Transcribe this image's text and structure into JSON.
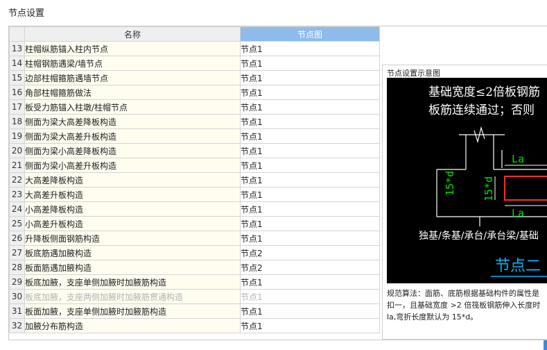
{
  "dialog": {
    "title": "节点设置"
  },
  "table": {
    "headers": {
      "name": "名称",
      "node": "节点图"
    },
    "rows": [
      {
        "num": "13",
        "name": "柱帽纵筋锚入柱内节点",
        "node": "节点1"
      },
      {
        "num": "14",
        "name": "柱帽钢筋遇梁/墙节点",
        "node": "节点1"
      },
      {
        "num": "15",
        "name": "边部柱帽箍筋遇墙节点",
        "node": "节点1"
      },
      {
        "num": "16",
        "name": "角部柱帽箍筋做法",
        "node": "节点1"
      },
      {
        "num": "17",
        "name": "板受力筋锚入柱墩/柱帽节点",
        "node": "节点1"
      },
      {
        "num": "18",
        "name": "侧面为梁大高差降板构造",
        "node": "节点1"
      },
      {
        "num": "19",
        "name": "侧面为梁大高差升板构造",
        "node": "节点1"
      },
      {
        "num": "20",
        "name": "侧面为梁小高差降板构造",
        "node": "节点1"
      },
      {
        "num": "21",
        "name": "侧面为梁小高差升板构造",
        "node": "节点1"
      },
      {
        "num": "22",
        "name": "大高差降板构造",
        "node": "节点1"
      },
      {
        "num": "23",
        "name": "大高差升板构造",
        "node": "节点1"
      },
      {
        "num": "24",
        "name": "小高差降板构造",
        "node": "节点1"
      },
      {
        "num": "25",
        "name": "小高差升板构造",
        "node": "节点1"
      },
      {
        "num": "26",
        "name": "升降板侧面钢筋构造",
        "node": "节点1"
      },
      {
        "num": "27",
        "name": "板底筋遇加腋构造",
        "node": "节点2"
      },
      {
        "num": "28",
        "name": "板面筋遇加腋构造",
        "node": "节点2"
      },
      {
        "num": "29",
        "name": "板底加腋，支座单侧加腋时加腋筋构造",
        "node": "节点1"
      },
      {
        "num": "30",
        "name": "板底加腋，支座两侧加腋时加腋筋贯通构造",
        "node": "节点1",
        "disabled": true
      },
      {
        "num": "31",
        "name": "板面加腋，支座单侧加腋时加腋筋构造",
        "node": "节点1"
      },
      {
        "num": "32",
        "name": "加腋分布筋构造",
        "node": "节点1"
      }
    ]
  },
  "diagram": {
    "title": "节点设置示意图",
    "line1": "基础宽度≤2倍板钢筋",
    "line2": "板筋连续通过；否则",
    "label_la_top": "La",
    "label_la_bottom": "La",
    "label_15d_left": "15*d",
    "label_15d_right": "15*d",
    "label_bottom": "独基/条基/承台/承台梁/基础",
    "node_label": "节点二",
    "colors": {
      "background": "#000000",
      "text": "#ffffff",
      "lines": "#ffffff",
      "dimension": "#00e000",
      "rebar": "#ff2a2a",
      "node_label": "#00b4ff"
    }
  },
  "description": {
    "line1": "规范算法：面筋、底筋根据基础构件的属性是",
    "line2": "扣一，且基础宽度 >2 倍筏板钢筋伸入长度时",
    "line3": "la,弯折长度默认为 15*d。"
  }
}
